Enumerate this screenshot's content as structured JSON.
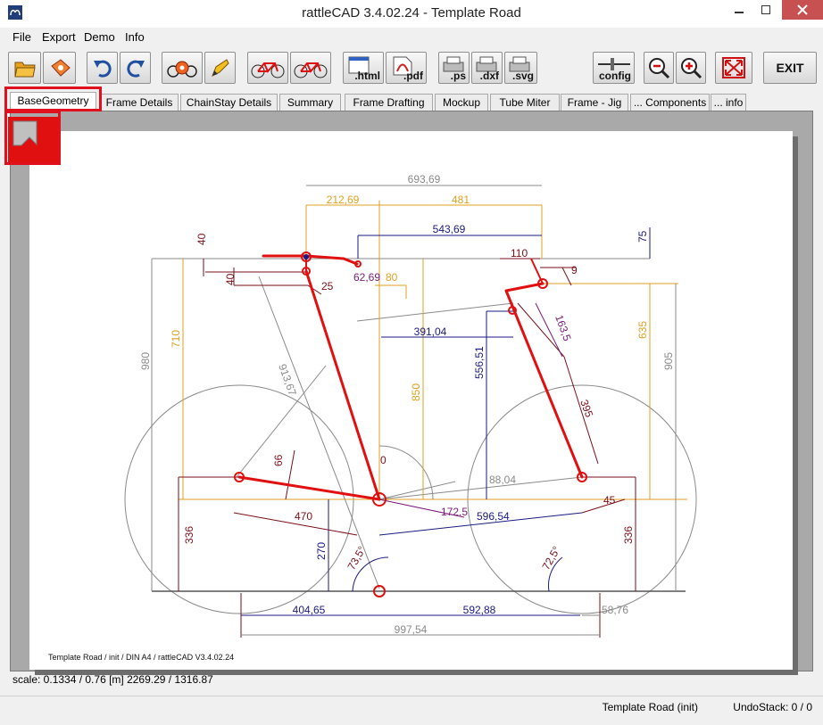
{
  "window": {
    "title": "rattleCAD  3.4.02.24 - Template Road"
  },
  "menu": [
    "File",
    "Export",
    "Demo",
    "Info"
  ],
  "toolbar": {
    "html_label": ".html",
    "pdf_label": ".pdf",
    "ps_label": ".ps",
    "dxf_label": ".dxf",
    "svg_label": ".svg",
    "config_label": "config",
    "exit_label": "EXIT"
  },
  "tabs": [
    "BaseGeometry",
    "Frame Details",
    "ChainStay Details",
    "Summary",
    "Frame Drafting",
    "Mockup",
    "Tube Miter",
    "Frame - Jig",
    "... Components",
    "... info"
  ],
  "drawing": {
    "dims": {
      "top_total": "693,69",
      "left_top": "212,69",
      "right_top": "481",
      "stack_reach": "543,69",
      "d40a": "40",
      "d40b": "40",
      "d25": "25",
      "d62": "62,69",
      "d80": "80",
      "d110": "110",
      "d75": "75",
      "d9": "9",
      "d710": "710",
      "d980": "980",
      "d913": "913,67",
      "d391": "391,04",
      "d556": "556,51",
      "d850": "850",
      "d635": "635",
      "d905": "905",
      "d163": "163,5",
      "d395": "395",
      "d0": "0",
      "d66": "66",
      "d88": "88,04",
      "d470": "470",
      "d1725": "172,5",
      "d596": "596,54",
      "d45": "45",
      "d336l": "336",
      "d336r": "336",
      "d270": "270",
      "a735": "73,5°",
      "a725": "72,5°",
      "d404": "404,65",
      "d592": "592,88",
      "d58": "58,76",
      "d997": "997,54"
    },
    "footer": "Template Road   /   init   /  DIN A4   /   rattleCAD   V3.4.02.24"
  },
  "scale_text": "scale: 0.1334 / 0.76  [m]  2269.29 / 1316.87",
  "status": {
    "project": "Template Road (init)",
    "undo": "UndoStack:   0 / 0"
  },
  "colors": {
    "frame": "#e01010",
    "dim_blue": "#1a1a80",
    "dim_orange": "#e0a020",
    "dim_dark": "#7a0f1a",
    "dim_purple": "#7a1a7a",
    "dim_gray": "#8a8a8a"
  }
}
